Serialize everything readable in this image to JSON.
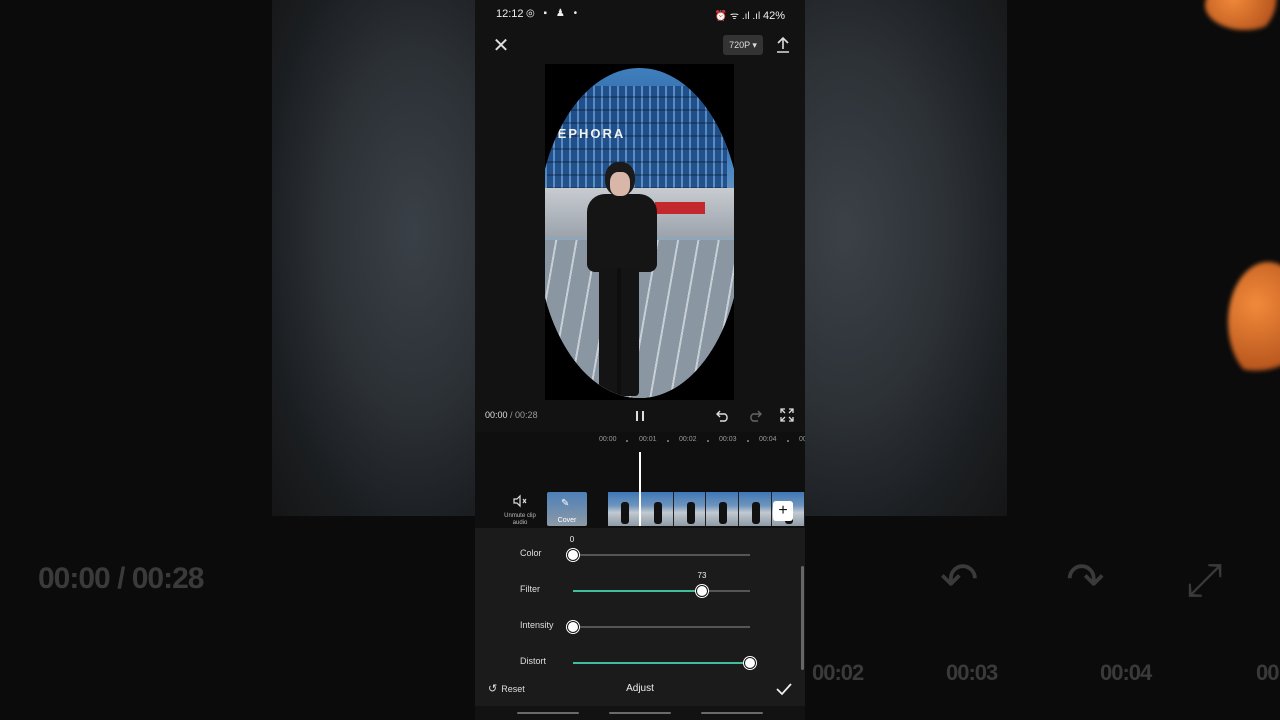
{
  "statusbar": {
    "time": "12:12",
    "left_icons": "◎ ▪ ♟ •",
    "right_icons": "⏰ ᯤ .ıl .ıl",
    "battery": "42%"
  },
  "header": {
    "resolution": "720P ▾"
  },
  "preview": {
    "sign_text": "SEPHORA"
  },
  "playback": {
    "current": "00:00",
    "separator": " / ",
    "total": "00:28"
  },
  "ruler": {
    "ticks": [
      "00:00",
      "00:01",
      "00:02",
      "00:03",
      "00:04",
      "00"
    ]
  },
  "timeline": {
    "mute_label": "Unmute clip audio",
    "cover_label": "Cover",
    "add_label": "+"
  },
  "adjust": {
    "title": "Adjust",
    "reset_label": "Reset",
    "accent_color": "#3fbf9a",
    "sliders": [
      {
        "label": "Color",
        "value": 0,
        "value_text": "0",
        "max": 100
      },
      {
        "label": "Filter",
        "value": 73,
        "value_text": "73",
        "max": 100
      },
      {
        "label": "Intensity",
        "value": 0,
        "value_text": "",
        "max": 100
      },
      {
        "label": "Distort",
        "value": 100,
        "value_text": "",
        "max": 100
      }
    ]
  },
  "background": {
    "time_text": "00:00 / 00:28",
    "ruler_text": [
      "00:02",
      "00:03",
      "00:04",
      "00"
    ]
  }
}
